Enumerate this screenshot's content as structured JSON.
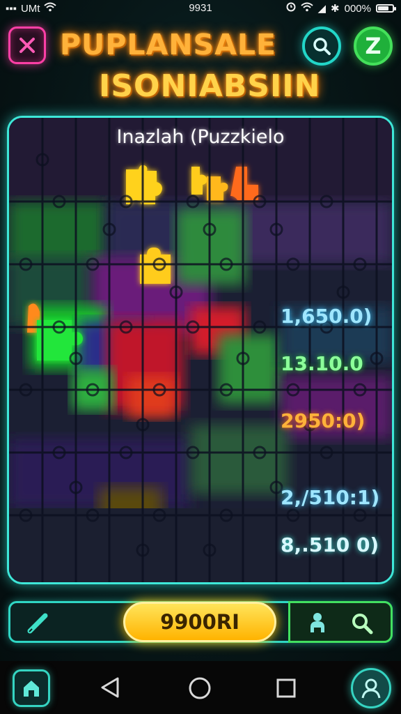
{
  "status_bar": {
    "carrier": "UMt",
    "time": "9931",
    "battery": "000%"
  },
  "header": {
    "title_line1": "PUPLANSALE",
    "title_line2": "ISONIABSIIN",
    "close_icon": "close-x-icon",
    "search_icon": "search-icon",
    "z_label": "Z"
  },
  "board": {
    "title": "Inazlah (Puzzkielo",
    "scores": [
      "1,650.0)",
      "13.10.0",
      "2950:0)",
      "2,/510:1)",
      "8,.510 0)"
    ]
  },
  "controls": {
    "center_label": "9900RI",
    "left_icon": "pencil-icon",
    "right_icons": [
      "person-icon",
      "search-icon"
    ]
  },
  "colors": {
    "accent_cyan": "#3ee7d8",
    "accent_green": "#44e05a",
    "accent_pink": "#ff3fa6",
    "title_orange": "#ffb23a",
    "button_yellow": "#ffc400"
  }
}
